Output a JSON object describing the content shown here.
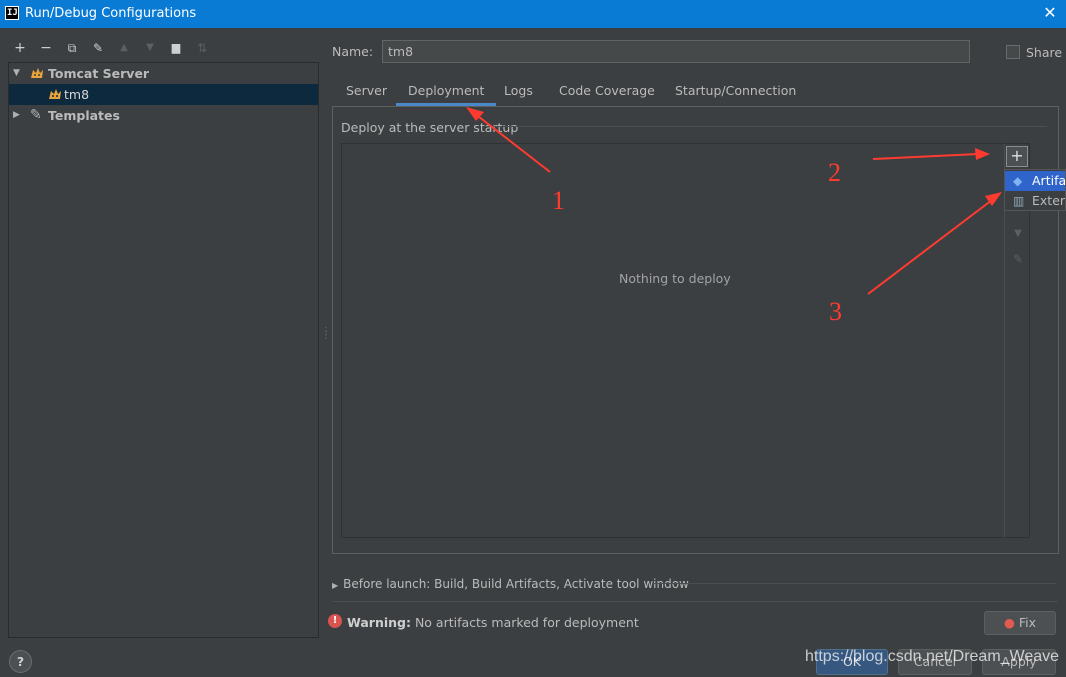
{
  "window": {
    "title": "Run/Debug Configurations",
    "app_icon": "IJ",
    "close_icon": "close-icon"
  },
  "toolbar": {
    "icons": [
      "add-icon",
      "remove-icon",
      "copy-icon",
      "wrench-icon",
      "move-up-icon",
      "move-down-icon",
      "new-folder-icon",
      "sort-icon"
    ],
    "glyphs": [
      "+",
      "−",
      "⧉",
      "🔧",
      "▲",
      "▼",
      "▆",
      "⇅"
    ]
  },
  "tree": {
    "groups": [
      {
        "label": "Tomcat Server",
        "expanded": true,
        "children": [
          {
            "label": "tm8",
            "selected": true
          }
        ]
      },
      {
        "label": "Templates",
        "expanded": false
      }
    ]
  },
  "name_field": {
    "label": "Name:",
    "value": "tm8"
  },
  "share": {
    "label": "Share",
    "checked": false
  },
  "tabs": [
    {
      "label": "Server",
      "active": false
    },
    {
      "label": "Deployment",
      "active": true
    },
    {
      "label": "Logs",
      "active": false
    },
    {
      "label": "Code Coverage",
      "active": false
    },
    {
      "label": "Startup/Connection",
      "active": false
    }
  ],
  "deployment": {
    "section_title": "Deploy at the server startup",
    "empty_text": "Nothing to deploy",
    "add_button": "+",
    "popup_items": [
      {
        "label": "Artifact...",
        "highlighted": true
      },
      {
        "label": "External Source...",
        "highlighted": false
      }
    ]
  },
  "before_launch": {
    "text": "Before launch: Build, Build Artifacts, Activate tool window"
  },
  "warning": {
    "bold": "Warning:",
    "text": " No artifacts marked for deployment"
  },
  "fix_button": {
    "label": "Fix"
  },
  "dialog_buttons": {
    "help": "?",
    "ok": "OK",
    "cancel": "Cancel",
    "apply": "Apply"
  },
  "watermark": "https://blog.csdn.net/Dream_Weave",
  "annotations": {
    "n1": "1",
    "n2": "2",
    "n3": "3",
    "color": "#ff3b30"
  }
}
